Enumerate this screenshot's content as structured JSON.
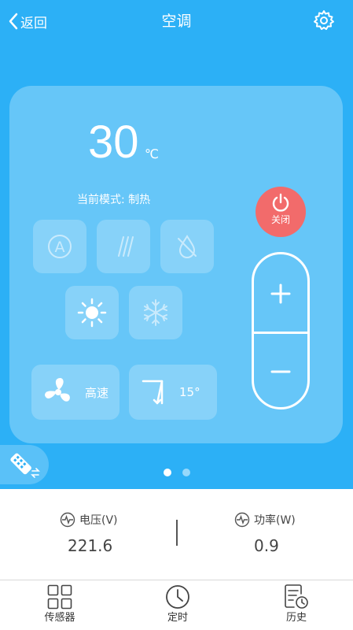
{
  "header": {
    "back_label": "返回",
    "title": "空调"
  },
  "control": {
    "temperature": "30",
    "temperature_unit": "℃",
    "mode_label": "当前模式: 制热",
    "power_label": "关闭",
    "fan_speed": "高速",
    "swing_angle": "15°",
    "plus_label": "+",
    "minus_label": "−"
  },
  "pager": {
    "pages": 2,
    "active_page": 1
  },
  "readings": {
    "voltage": {
      "label": "电压(V)",
      "value": "221.6"
    },
    "power": {
      "label": "功率(W)",
      "value": "0.9"
    }
  },
  "tabs": [
    {
      "label": "传感器",
      "icon": "grid-icon"
    },
    {
      "label": "定时",
      "icon": "clock-icon"
    },
    {
      "label": "历史",
      "icon": "history-icon"
    }
  ],
  "colors": {
    "accent": "#2cb0f6",
    "power": "#f26b6b"
  }
}
